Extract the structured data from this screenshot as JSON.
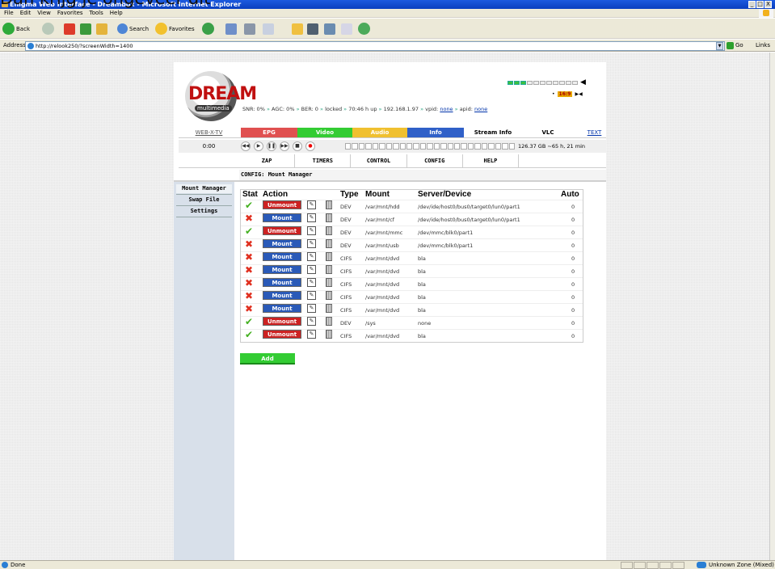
{
  "overlay": {
    "text": "Dan krijg je ongeveer dit"
  },
  "window": {
    "title": "Enigma Web Interface - Dreambox - Microsoft Internet Explorer",
    "controls": [
      "_",
      "□",
      "X"
    ]
  },
  "menu": {
    "items": [
      "File",
      "Edit",
      "View",
      "Favorites",
      "Tools",
      "Help"
    ]
  },
  "toolbar": {
    "back": "Back",
    "search": "Search",
    "favorites": "Favorites"
  },
  "address": {
    "label": "Address",
    "url": "http://relook250/?screenWidth=1400",
    "go": "Go",
    "links": "Links"
  },
  "brand": {
    "logo_text": "DREAM",
    "logo_sub": "multimedia"
  },
  "status": {
    "snr": "SNR: 0%",
    "agc": "AGC: 0%",
    "ber": "BER: 0",
    "lock": "locked",
    "uptime": "70:46 h up",
    "ip": "192.168.1.97",
    "vpid_label": "vpid:",
    "vpid": "none",
    "apid_label": "apid:",
    "apid": "none"
  },
  "volume": {
    "level": 0.3,
    "badge": "16:9"
  },
  "nav_top": {
    "webtv": "WEB-X-TV",
    "epg": "EPG",
    "video": "Video",
    "audio": "Audio",
    "info": "Info",
    "stream": "Stream Info",
    "vlc": "VLC",
    "text": "TEXT"
  },
  "player": {
    "time": "0:00",
    "disk": "126.37 GB ~65 h, 21 min"
  },
  "nav_main": [
    "ZAP",
    "TIMERS",
    "CONTROL",
    "CONFIG",
    "HELP"
  ],
  "page_title": "CONFIG: Mount Manager",
  "sidebar": [
    "Mount Manager",
    "Swap File",
    "Settings"
  ],
  "table": {
    "headers": {
      "stat": "Stat",
      "action": "Action",
      "type": "Type",
      "mount": "Mount",
      "server": "Server/Device",
      "auto": "Auto"
    },
    "rows": [
      {
        "ok": "✔",
        "action": "Unmount",
        "type": "DEV",
        "mount": "/var/mnt/hdd",
        "server": "/dev/ide/host0/bus0/target0/lun0/part1",
        "auto": "0"
      },
      {
        "ok": "✖",
        "action": "Mount",
        "type": "DEV",
        "mount": "/var/mnt/cf",
        "server": "/dev/ide/host0/bus0/target0/lun0/part1",
        "auto": "0"
      },
      {
        "ok": "✔",
        "action": "Unmount",
        "type": "DEV",
        "mount": "/var/mnt/mmc",
        "server": "/dev/mmc/blk0/part1",
        "auto": "0"
      },
      {
        "ok": "✖",
        "action": "Mount",
        "type": "DEV",
        "mount": "/var/mnt/usb",
        "server": "/dev/mmc/blk0/part1",
        "auto": "0"
      },
      {
        "ok": "✖",
        "action": "Mount",
        "type": "CIFS",
        "mount": "/var/mnt/dvd",
        "server": "bla",
        "auto": "0"
      },
      {
        "ok": "✖",
        "action": "Mount",
        "type": "CIFS",
        "mount": "/var/mnt/dvd",
        "server": "bla",
        "auto": "0"
      },
      {
        "ok": "✖",
        "action": "Mount",
        "type": "CIFS",
        "mount": "/var/mnt/dvd",
        "server": "bla",
        "auto": "0"
      },
      {
        "ok": "✖",
        "action": "Mount",
        "type": "CIFS",
        "mount": "/var/mnt/dvd",
        "server": "bla",
        "auto": "0"
      },
      {
        "ok": "✖",
        "action": "Mount",
        "type": "CIFS",
        "mount": "/var/mnt/dvd",
        "server": "bla",
        "auto": "0"
      },
      {
        "ok": "✔",
        "action": "Unmount",
        "type": "DEV",
        "mount": "/sys",
        "server": "none",
        "auto": "0"
      },
      {
        "ok": "✔",
        "action": "Unmount",
        "type": "CIFS",
        "mount": "/var/mnt/dvd",
        "server": "bla",
        "auto": "0"
      }
    ]
  },
  "add_button": "Add",
  "statusbar": {
    "done": "Done",
    "zone": "Unknown Zone (Mixed)"
  }
}
